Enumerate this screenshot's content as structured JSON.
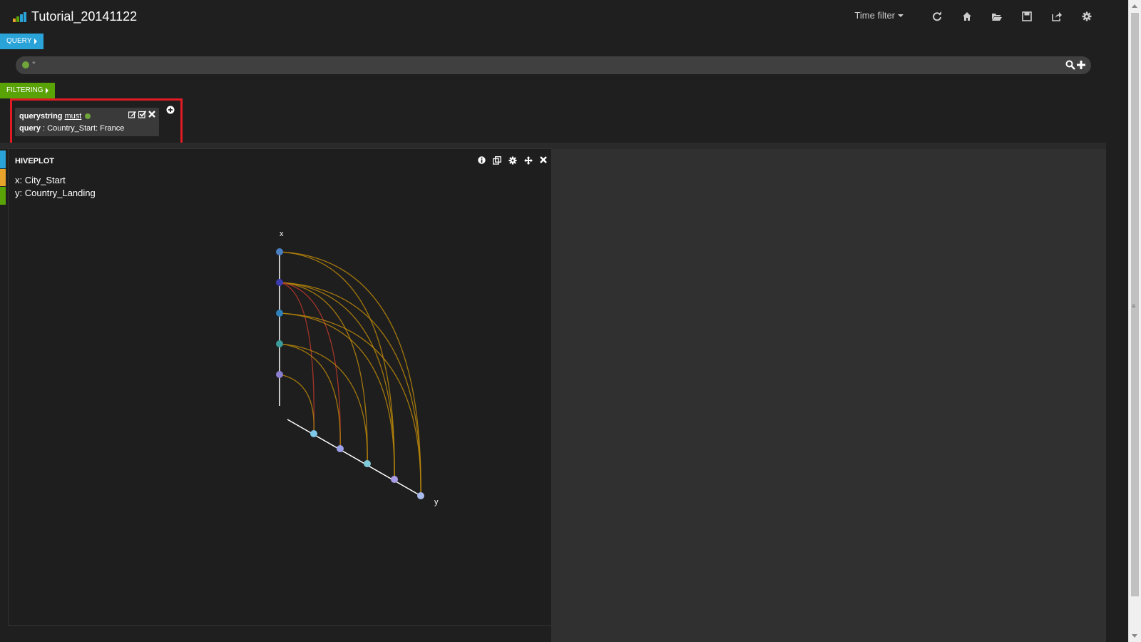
{
  "header": {
    "title": "Tutorial_20141122",
    "time_filter": "Time filter"
  },
  "query": {
    "label": "QUERY",
    "value": "*"
  },
  "filtering": {
    "label": "FILTERING",
    "filter": {
      "type": "querystring",
      "mode": "must",
      "key": "query",
      "separator": " : ",
      "value": "Country_Start: France"
    }
  },
  "panel": {
    "title": "HIVEPLOT",
    "x_axis_line": "x: City_Start",
    "y_axis_line": "y: Country_Landing",
    "axis_x_label": "x",
    "axis_y_label": "y"
  },
  "colors": {
    "query_tab": "#2aa3d9",
    "filtering_tab": "#5aa306",
    "highlight": "#e01b24",
    "link": "#b8860b",
    "link_strong": "#c0392b",
    "x_nodes": [
      "#4a7fc1",
      "#3b3bb0",
      "#2f7fb8",
      "#3b9a9a",
      "#8a7fd0"
    ],
    "y_nodes": [
      "#7fc8e8",
      "#9ba0e8",
      "#7fc8d8",
      "#a89be8",
      "#aabbee"
    ]
  },
  "icons": {
    "nav": [
      "refresh-icon",
      "home-icon",
      "folder-open-icon",
      "save-icon",
      "share-icon",
      "gear-icon"
    ],
    "panel": [
      "info-icon",
      "copy-icon",
      "gear-icon",
      "move-icon",
      "close-icon"
    ]
  }
}
